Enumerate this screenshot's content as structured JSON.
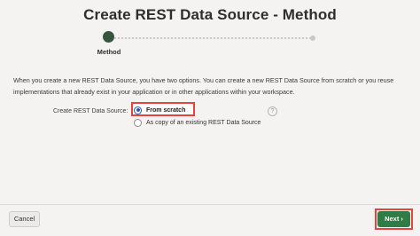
{
  "dialog": {
    "title": "Create REST Data Source - Method"
  },
  "wizard": {
    "steps": [
      {
        "label": "Method",
        "state": "current"
      },
      {
        "label": "",
        "state": "upcoming"
      }
    ]
  },
  "description": "When you create a new REST Data Source, you have two options. You can create a new REST Data Source from scratch or you reuse implementations that already exist in your application or in other applications within your workspace.",
  "form": {
    "field_label": "Create REST Data Source:",
    "options": [
      {
        "label": "From scratch",
        "selected": true
      },
      {
        "label": "As copy of an existing REST Data Source",
        "selected": false
      }
    ],
    "help_icon": "?"
  },
  "footer": {
    "cancel_label": "Cancel",
    "next_label": "Next",
    "next_icon": "›"
  },
  "colors": {
    "accent": "#2f7d45",
    "wizard_active": "#36553e",
    "highlight": "#e6433a",
    "background": "#f4f3f2"
  }
}
